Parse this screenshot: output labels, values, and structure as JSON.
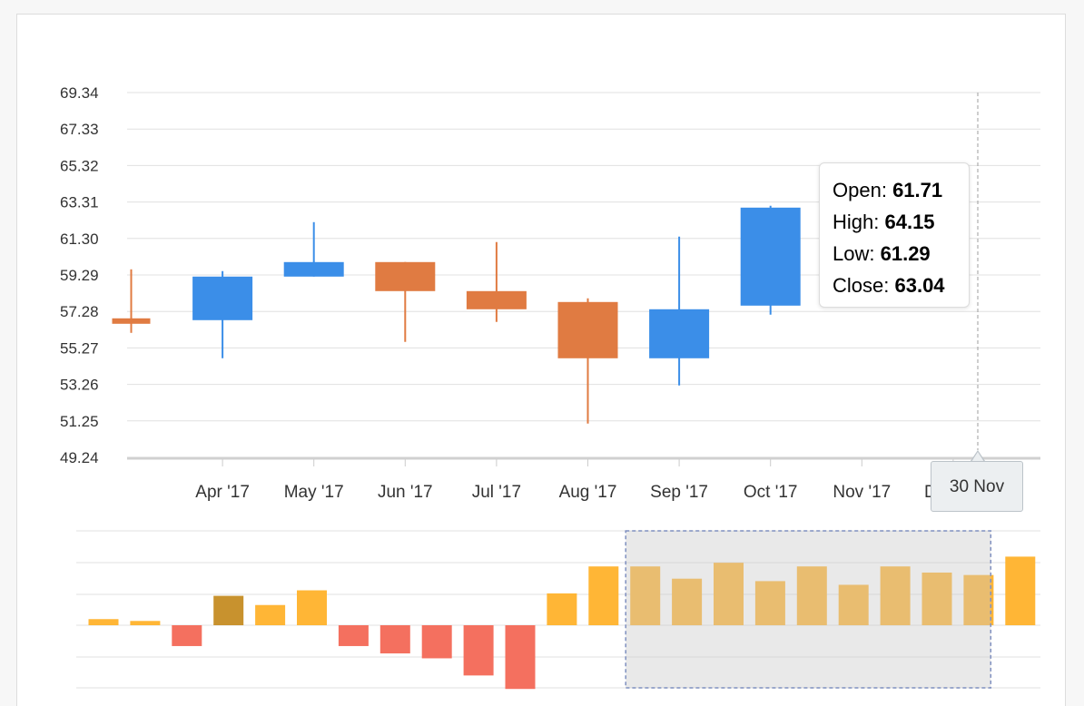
{
  "chart_data": [
    {
      "type": "candlestick",
      "y_ticks": [
        "69.34",
        "67.33",
        "65.32",
        "63.31",
        "61.30",
        "59.29",
        "57.28",
        "55.27",
        "53.26",
        "51.25",
        "49.24"
      ],
      "ylim": [
        49.24,
        69.34
      ],
      "x_tick_labels": [
        "Apr '17",
        "May '17",
        "Jun '17",
        "Jul '17",
        "Aug '17",
        "Sep '17",
        "Oct '17",
        "Nov '17",
        "Dec '17"
      ],
      "candles": [
        {
          "open": 56.9,
          "high": 59.6,
          "low": 56.1,
          "close": 56.6
        },
        {
          "open": 56.8,
          "high": 59.5,
          "low": 54.7,
          "close": 59.2
        },
        {
          "open": 59.2,
          "high": 62.2,
          "low": 59.2,
          "close": 60.0
        },
        {
          "open": 60.0,
          "high": 60.0,
          "low": 55.6,
          "close": 58.4
        },
        {
          "open": 58.4,
          "high": 61.1,
          "low": 56.7,
          "close": 57.4
        },
        {
          "open": 57.8,
          "high": 58.0,
          "low": 51.1,
          "close": 54.7
        },
        {
          "open": 54.7,
          "high": 61.4,
          "low": 53.2,
          "close": 57.4
        },
        {
          "open": 57.6,
          "high": 63.1,
          "low": 57.1,
          "close": 63.0
        },
        {
          "open": 61.71,
          "high": 64.15,
          "low": 61.29,
          "close": 63.04
        }
      ],
      "colors": {
        "up": "#3b8ee8",
        "down": "#e07b42"
      },
      "grid": true
    },
    {
      "type": "bar",
      "values": [
        0.5,
        0.35,
        -1.7,
        2.4,
        1.65,
        2.85,
        -1.7,
        -2.3,
        -2.7,
        -4.1,
        -5.2,
        2.6,
        4.8,
        4.8,
        3.8,
        5.1,
        3.6,
        4.8,
        3.3,
        4.8,
        4.3,
        4.1,
        5.6
      ],
      "colors": {
        "positive": "#ffb636",
        "negative": "#f4705f",
        "highlight": "#c8922e"
      },
      "highlight_index": 3,
      "selection": {
        "start_index": 13,
        "end_index": 22
      },
      "grid": true
    }
  ],
  "tooltip": {
    "open_label": "Open:",
    "open_value": "61.71",
    "high_label": "High:",
    "high_value": "64.15",
    "low_label": "Low:",
    "low_value": "61.29",
    "close_label": "Close:",
    "close_value": "63.04"
  },
  "crosshair": {
    "x_label": "30 Nov"
  }
}
